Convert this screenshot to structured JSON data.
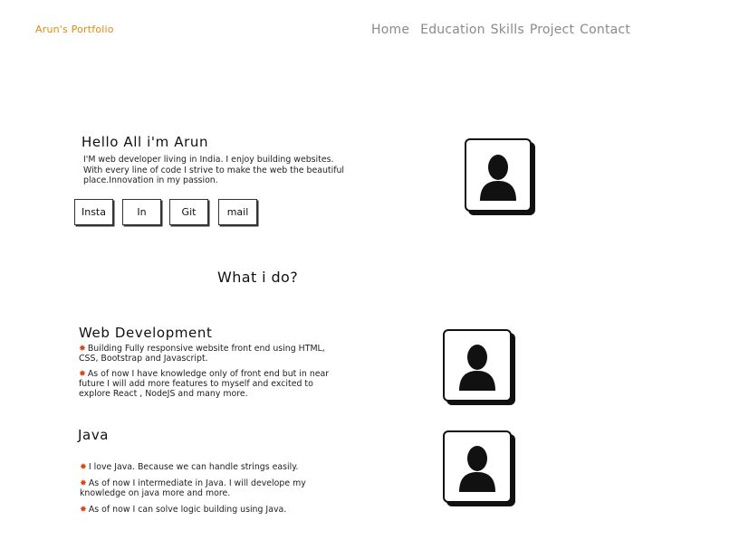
{
  "header": {
    "brand": "Arun's Portfolio",
    "nav": [
      "Home",
      "Education",
      "Skills",
      "Project",
      "Contact"
    ]
  },
  "hero": {
    "greeting": "Hello All i'm Arun",
    "intro": "I'M web developer living in India. I enjoy building websites. With every line of code I strive to make the web the beautiful place.Innovation in my passion.",
    "buttons": [
      "Insta",
      "In",
      "Git",
      "mail"
    ]
  },
  "what_i_do": {
    "title": "What i do?"
  },
  "sections": [
    {
      "title": "Web Development",
      "points": [
        "Building Fully responsive website front end using HTML, CSS, Bootstrap and Javascript.",
        "As of now I have knowledge only of front end but in near future I will add more features to myself and excited to explore React , NodeJS and many more."
      ]
    },
    {
      "title": "Java",
      "points": [
        "I love Java. Because we can handle strings easily.",
        "As of now I intermediate in Java. I will develope my knowledge on java more and more.",
        "As of now I can solve logic building using Java."
      ]
    }
  ],
  "colors": {
    "brand": "#e08a18",
    "nav": "#8a8a8a",
    "spark": "#d24a1a"
  },
  "icons": {
    "avatar": "user-silhouette-icon",
    "bullet": "spark-icon"
  }
}
